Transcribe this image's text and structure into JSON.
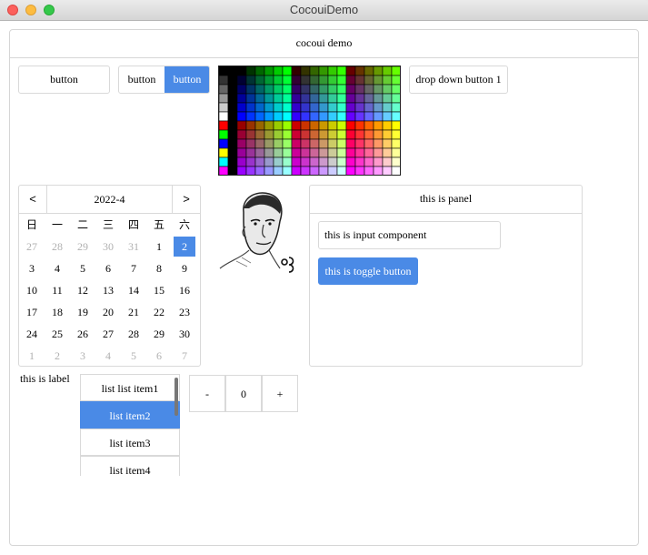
{
  "window": {
    "title": "CocouiDemo"
  },
  "frame": {
    "title": "cocoui demo"
  },
  "buttons": {
    "plain": "button",
    "segment_left": "button",
    "segment_right": "button",
    "dropdown": "drop down button 1"
  },
  "colors": {
    "accent": "#4a8ae6"
  },
  "calendar": {
    "prev": "<",
    "next": ">",
    "month": "2022-4",
    "weekdays": [
      "日",
      "一",
      "二",
      "三",
      "四",
      "五",
      "六"
    ],
    "weeks": [
      [
        "27",
        "28",
        "29",
        "30",
        "31",
        "1",
        "2"
      ],
      [
        "3",
        "4",
        "5",
        "6",
        "7",
        "8",
        "9"
      ],
      [
        "10",
        "11",
        "12",
        "13",
        "14",
        "15",
        "16"
      ],
      [
        "17",
        "18",
        "19",
        "20",
        "21",
        "22",
        "23"
      ],
      [
        "24",
        "25",
        "26",
        "27",
        "28",
        "29",
        "30"
      ],
      [
        "1",
        "2",
        "3",
        "4",
        "5",
        "6",
        "7"
      ]
    ],
    "selected": "2"
  },
  "panel": {
    "title": "this is panel",
    "input_value": "this is input component",
    "toggle_label": "this is toggle button"
  },
  "label": "this is label",
  "list": {
    "items": [
      "list list item1",
      "list item2",
      "list item3",
      "list item4"
    ],
    "selected_index": 1
  },
  "stepper": {
    "minus": "-",
    "value": "0",
    "plus": "+"
  }
}
